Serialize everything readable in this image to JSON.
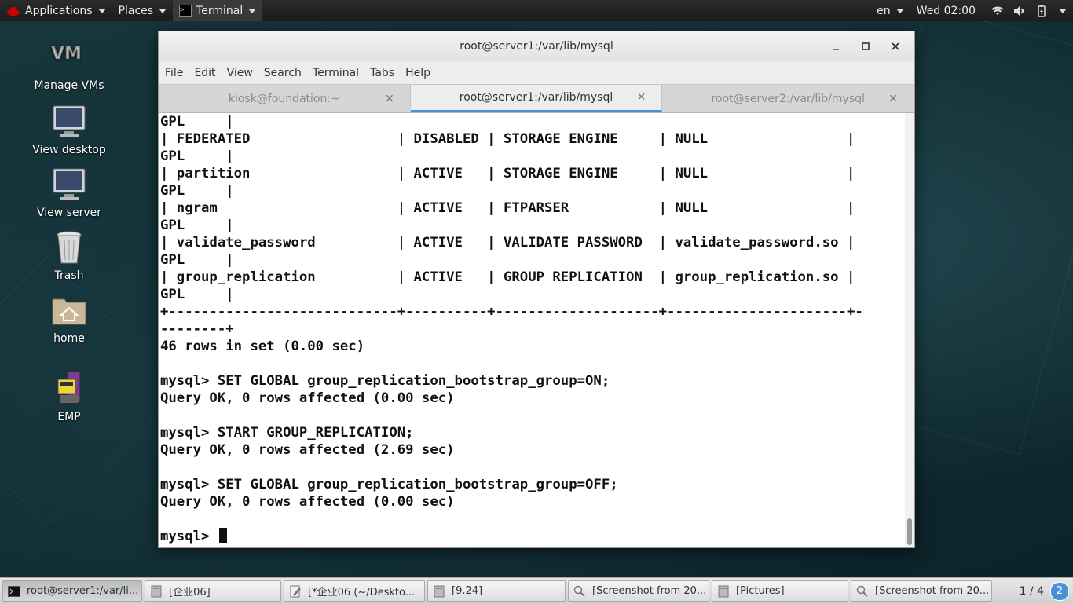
{
  "topbar": {
    "applications": "Applications",
    "places": "Places",
    "terminal": "Terminal",
    "language": "en",
    "clock": "Wed 02:00"
  },
  "desktop_icons": [
    {
      "label": "Manage VMs",
      "icon": "vm-icon"
    },
    {
      "label": "View desktop",
      "icon": "monitor-icon"
    },
    {
      "label": "View server",
      "icon": "monitor-icon"
    },
    {
      "label": "Trash",
      "icon": "trash-icon"
    },
    {
      "label": "home",
      "icon": "home-folder-icon"
    },
    {
      "label": "EMP",
      "icon": "emp-icon"
    }
  ],
  "window": {
    "title": "root@server1:/var/lib/mysql",
    "menu": [
      "File",
      "Edit",
      "View",
      "Search",
      "Terminal",
      "Tabs",
      "Help"
    ],
    "tabs": [
      {
        "label": "kiosk@foundation:~",
        "active": false
      },
      {
        "label": "root@server1:/var/lib/mysql",
        "active": true
      },
      {
        "label": "root@server2:/var/lib/mysql",
        "active": false
      }
    ]
  },
  "terminal": {
    "lines": [
      "GPL     |",
      "| FEDERATED                  | DISABLED | STORAGE ENGINE     | NULL                 |",
      "GPL     |",
      "| partition                  | ACTIVE   | STORAGE ENGINE     | NULL                 |",
      "GPL     |",
      "| ngram                      | ACTIVE   | FTPARSER           | NULL                 |",
      "GPL     |",
      "| validate_password          | ACTIVE   | VALIDATE PASSWORD  | validate_password.so |",
      "GPL     |",
      "| group_replication          | ACTIVE   | GROUP REPLICATION  | group_replication.so |",
      "GPL     |",
      "+----------------------------+----------+--------------------+----------------------+-",
      "--------+",
      "46 rows in set (0.00 sec)",
      "",
      "mysql> SET GLOBAL group_replication_bootstrap_group=ON;",
      "Query OK, 0 rows affected (0.00 sec)",
      "",
      "mysql> START GROUP_REPLICATION;",
      "Query OK, 0 rows affected (2.69 sec)",
      "",
      "mysql> SET GLOBAL group_replication_bootstrap_group=OFF;",
      "Query OK, 0 rows affected (0.00 sec)",
      ""
    ],
    "prompt": "mysql> "
  },
  "taskbar": {
    "tasks": [
      {
        "label": "root@server1:/var/li...",
        "icon": "terminal-icon",
        "active": true
      },
      {
        "label": "[企业06]",
        "icon": "file-manager-icon",
        "active": false
      },
      {
        "label": "[*企业06 (~/Deskto...",
        "icon": "text-editor-icon",
        "active": false
      },
      {
        "label": "[9.24]",
        "icon": "file-manager-icon",
        "active": false
      },
      {
        "label": "[Screenshot from 20...",
        "icon": "image-viewer-icon",
        "active": false
      },
      {
        "label": "[Pictures]",
        "icon": "file-manager-icon",
        "active": false
      },
      {
        "label": "[Screenshot from 20...",
        "icon": "image-viewer-icon",
        "active": false
      }
    ],
    "workspace": "1 / 4",
    "notifications": "2"
  },
  "colors": {
    "accent": "#4a90d9",
    "terminal_bg": "#ffffff",
    "terminal_fg": "#111111"
  }
}
